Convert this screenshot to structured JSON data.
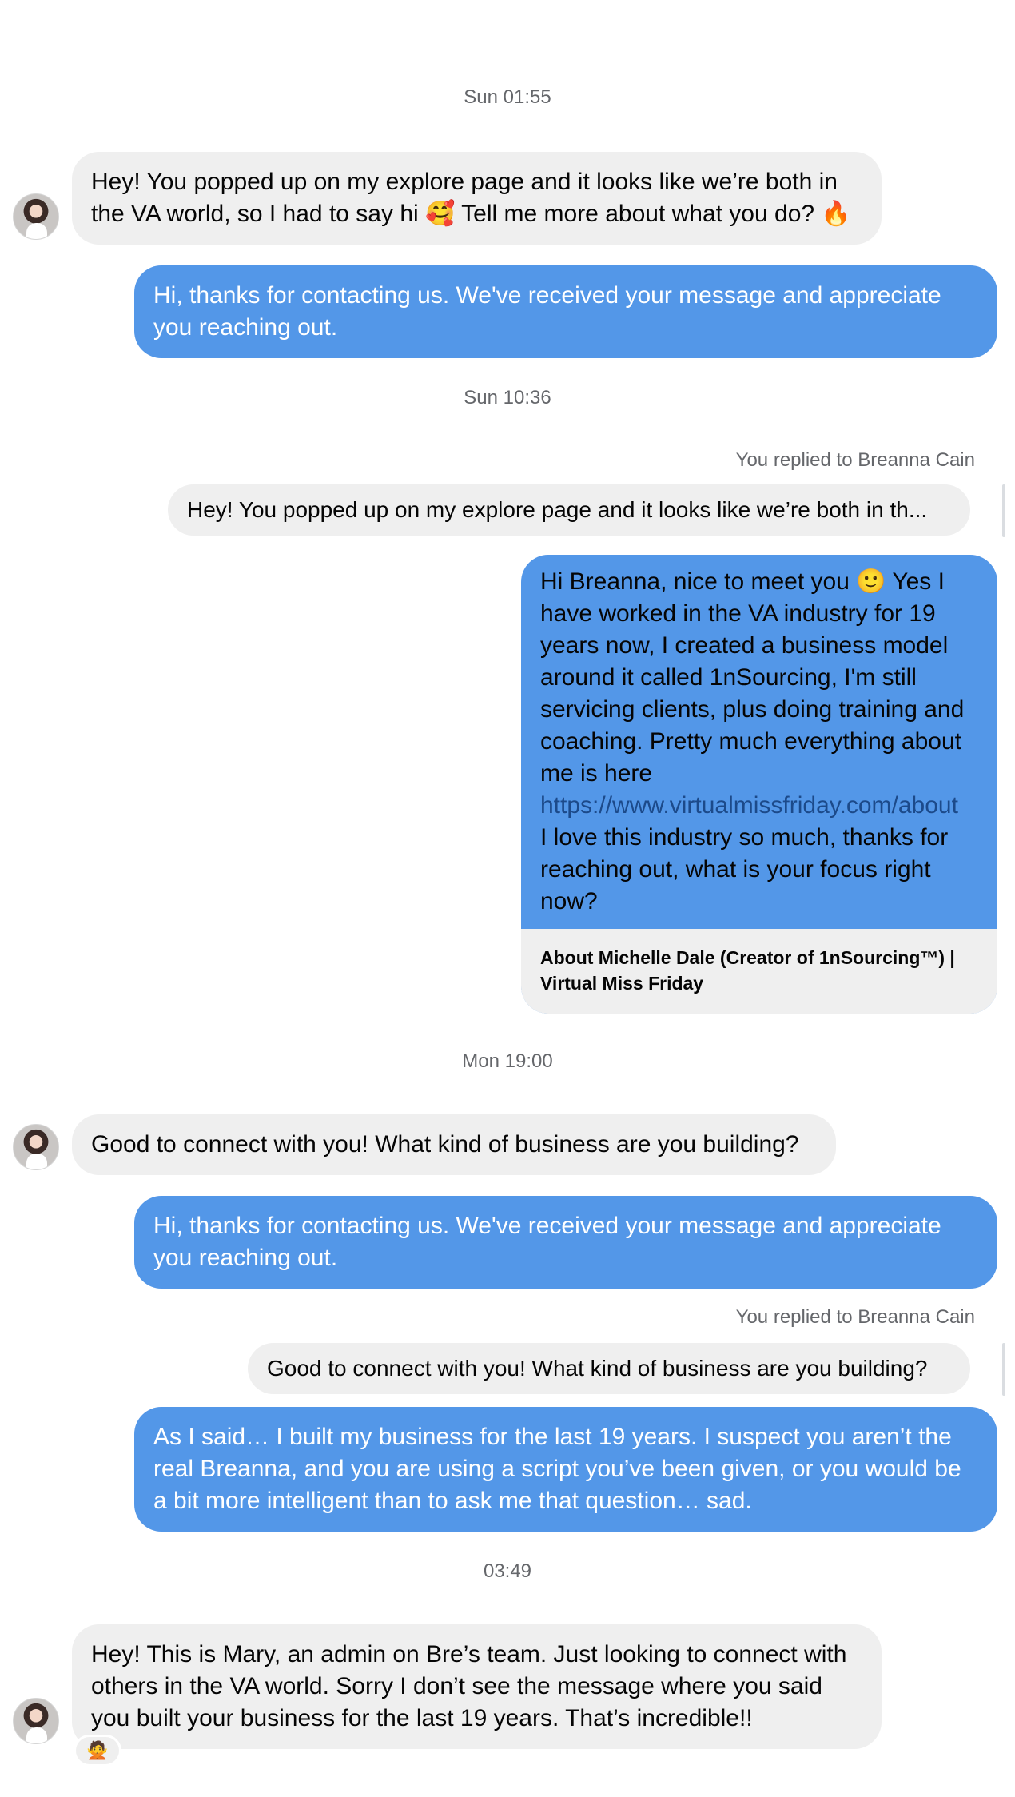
{
  "timestamps": [
    "Sun 01:55",
    "Sun 10:36",
    "Mon 19:00",
    "03:49"
  ],
  "messages": {
    "m1": "Hey! You popped up on my explore page and it looks like we’re both in the VA world, so I had to say hi 🥰 Tell me more about what you do? 🔥",
    "m2": "Hi, thanks for contacting us. We've received your message and appreciate you reaching out.",
    "reply1_label": "You replied to Breanna Cain",
    "reply1_quote": "Hey! You popped up on my explore page and it looks like we’re both in th...",
    "m3_text": "Hi Breanna, nice to meet you 🙂 Yes I have worked in the VA industry for 19 years now, I created a business model around it called 1nSourcing, I'm still servicing clients, plus doing training and coaching. Pretty much everything about me is here",
    "m3_link": "https://www.virtualmissfriday.com/about",
    "m3_text2": "I love this industry so much, thanks for reaching out, what is your focus right now?",
    "m3_card_title": "About Michelle Dale (Creator of 1nSourcing™) | Virtual Miss Friday",
    "m4": "Good to connect with you! What kind of business are you building?",
    "m5": "Hi, thanks for contacting us. We've received your message and appreciate you reaching out.",
    "reply2_label": "You replied to Breanna Cain",
    "reply2_quote": "Good to connect with you! What kind of business are you building?",
    "m6": "As I said… I built my business for the last 19 years. I suspect you aren’t the real Breanna, and you are using a script you’ve been given, or you would be a bit more intelligent than to ask me that question… sad.",
    "m7": "Hey! This is Mary, an admin on Bre’s team. Just looking to connect with others in the VA world. Sorry I don’t see the message where you said you built your business for the last 19 years. That’s incredible!!",
    "m7_reaction": "🙅"
  },
  "colors": {
    "outgoing": "#5397e8",
    "incoming": "#efefef",
    "meta_text": "#65676b"
  },
  "icons": {
    "avatar": "contact-avatar"
  }
}
